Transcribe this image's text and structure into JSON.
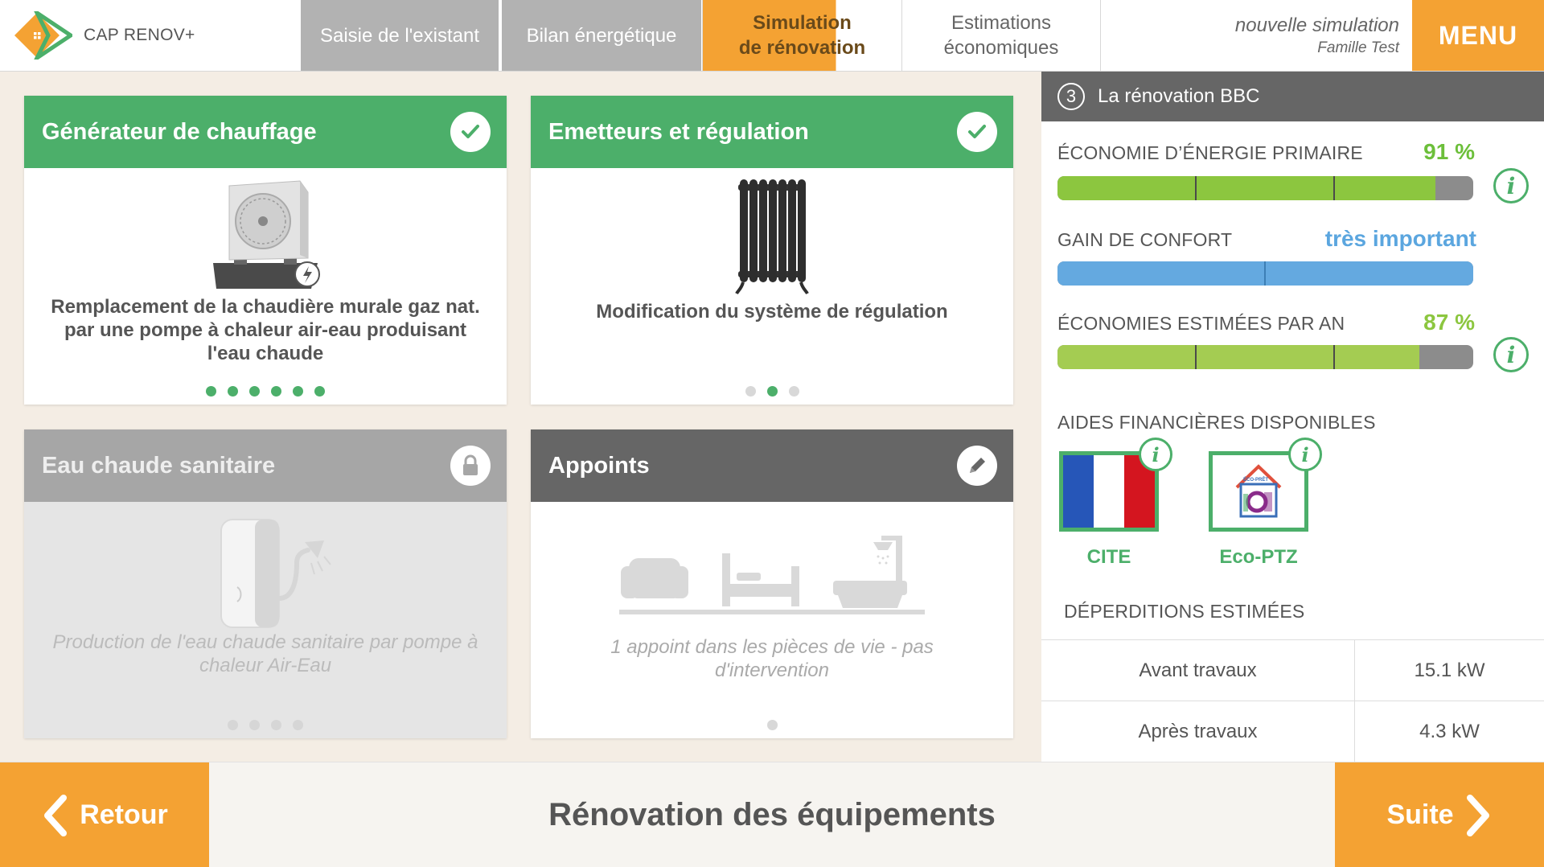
{
  "app": {
    "title": "CAP RENOV+"
  },
  "tabs": [
    {
      "label_line1": "Saisie de l'existant",
      "label_line2": ""
    },
    {
      "label_line1": "Bilan énergétique",
      "label_line2": ""
    },
    {
      "label_line1": "Simulation",
      "label_line2": "de rénovation"
    },
    {
      "label_line1": "Estimations",
      "label_line2": "économiques"
    }
  ],
  "simulation": {
    "title": "nouvelle simulation",
    "family": "Famille Test"
  },
  "menu_label": "MENU",
  "cards": [
    {
      "title": "Générateur de chauffage",
      "status": "done",
      "status_icon": "check-icon",
      "image": "heat-pump-icon",
      "text": "Remplacement de la chaudière murale gaz nat. par une pompe à chaleur air-eau produisant l'eau chaude",
      "dots_total": 6,
      "dot_active": [
        1,
        1,
        1,
        1,
        1,
        1
      ]
    },
    {
      "title": "Emetteurs et régulation",
      "status": "done",
      "status_icon": "check-icon",
      "image": "radiator-icon",
      "text": "Modification du système de régulation",
      "dots_total": 3,
      "dot_active": [
        0,
        1,
        0
      ]
    },
    {
      "title": "Eau chaude sanitaire",
      "status": "locked",
      "status_icon": "lock-icon",
      "image": "water-heater-icon",
      "text": "Production de l'eau chaude sanitaire par pompe à chaleur Air-Eau",
      "dots_total": 4,
      "dot_active": [
        0,
        0,
        0,
        0
      ]
    },
    {
      "title": "Appoints",
      "status": "editable",
      "status_icon": "pencil-icon",
      "image": "rooms-icon",
      "text": "1 appoint dans les pièces de vie - pas d'intervention",
      "dots_total": 1,
      "dot_active": [
        0
      ]
    }
  ],
  "panel": {
    "step": "3",
    "title": "La rénovation BBC",
    "metrics": [
      {
        "label": "ÉCONOMIE D’ÉNERGIE PRIMAIRE",
        "value": "91 %",
        "fill": 0.91,
        "color": "#8cc63f",
        "value_color": "#6cbf3a"
      },
      {
        "label": "GAIN DE CONFORT",
        "value": "très important",
        "fill": 1.0,
        "color": "#64a9e0",
        "value_color": "#5ba6df"
      },
      {
        "label": "ÉCONOMIES ESTIMÉES PAR AN",
        "value": "87 %",
        "fill": 0.87,
        "color": "#a4cc52",
        "value_color": "#8cc63f"
      }
    ],
    "aids_title": "AIDES FINANCIÈRES DISPONIBLES",
    "aids": [
      {
        "label": "CITE",
        "icon": "france-flag-icon"
      },
      {
        "label": "Eco-PTZ",
        "icon": "eco-ptz-icon",
        "logo_text": "ÉCO-PRÊT"
      }
    ],
    "losses_title": "DÉPERDITIONS ESTIMÉES",
    "losses": [
      {
        "label": "Avant travaux",
        "value": "15.1 kW"
      },
      {
        "label": "Après travaux",
        "value": "4.3 kW"
      }
    ]
  },
  "footer": {
    "back": "Retour",
    "title": "Rénovation des équipements",
    "next": "Suite"
  }
}
